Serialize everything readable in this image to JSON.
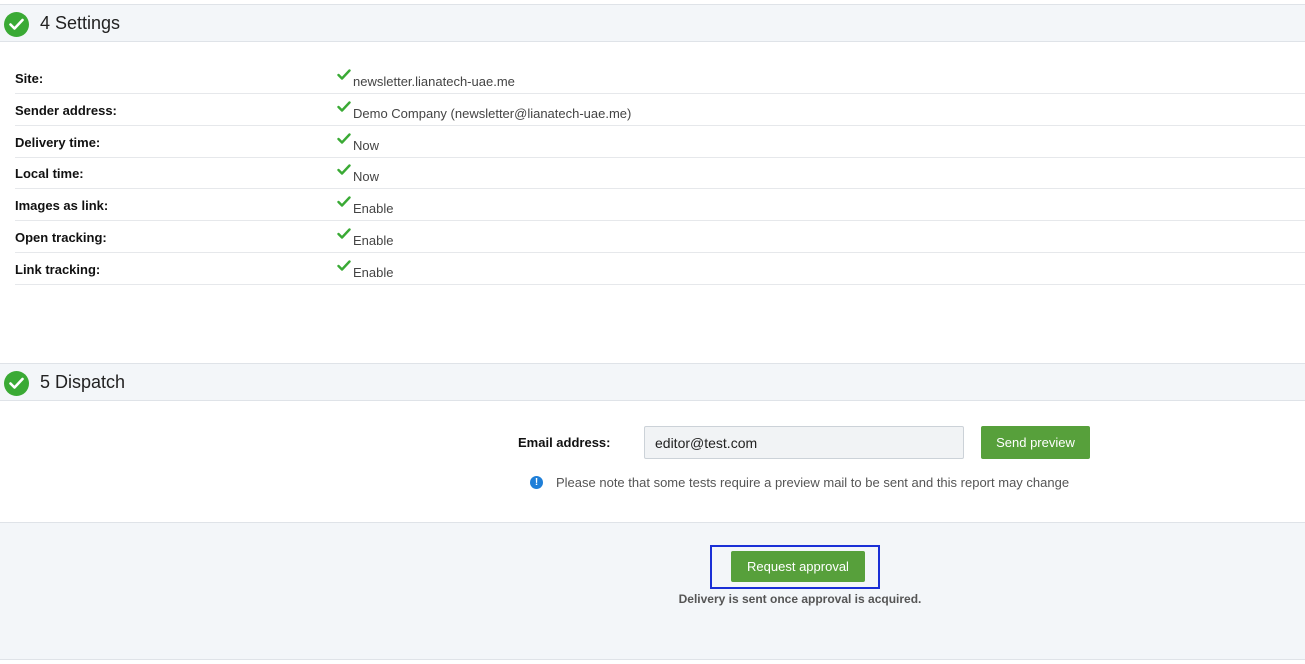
{
  "settings_section": {
    "title": "4 Settings",
    "rows": [
      {
        "label": "Site:",
        "value": "newsletter.lianatech-uae.me"
      },
      {
        "label": "Sender address:",
        "value": "Demo Company (newsletter@lianatech-uae.me)"
      },
      {
        "label": "Delivery time:",
        "value": "Now"
      },
      {
        "label": "Local time:",
        "value": "Now"
      },
      {
        "label": "Images as link:",
        "value": "Enable"
      },
      {
        "label": "Open tracking:",
        "value": "Enable"
      },
      {
        "label": "Link tracking:",
        "value": "Enable"
      }
    ]
  },
  "dispatch_section": {
    "title": "5 Dispatch",
    "email_label": "Email address:",
    "email_value": "editor@test.com",
    "send_preview_label": "Send preview",
    "notice_text": "Please note that some tests require a preview mail to be sent and this report may change",
    "request_approval_label": "Request approval",
    "approval_note": "Delivery is sent once approval is acquired."
  },
  "icons": {
    "section_status": "check-circle-icon",
    "row_status": "checkmark-icon",
    "notice": "info-icon"
  },
  "colors": {
    "success_green": "#3aaa35",
    "button_green": "#57a03b",
    "info_blue": "#1f7fd8",
    "highlight_blue": "#1a2fd6"
  }
}
